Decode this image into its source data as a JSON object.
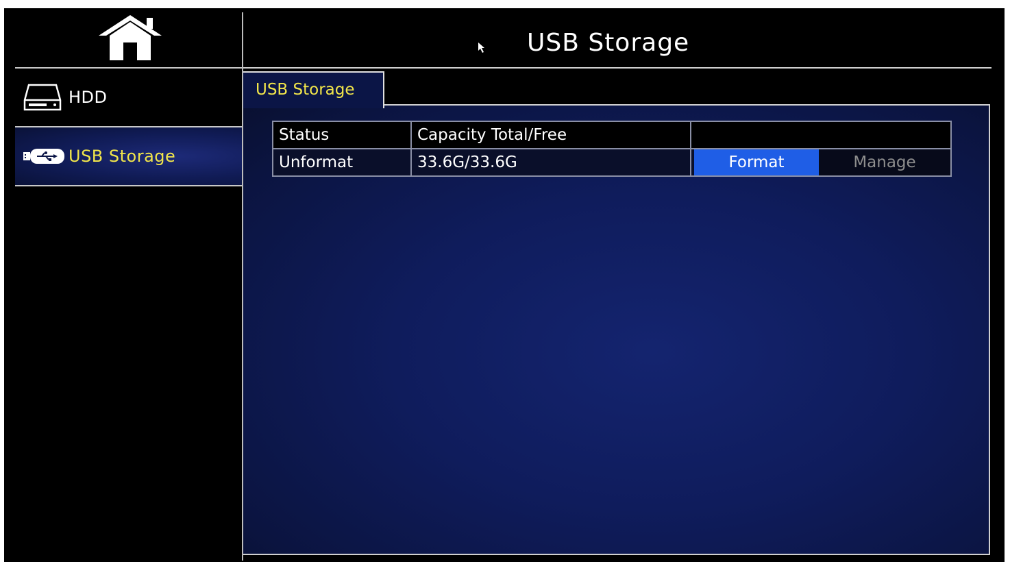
{
  "header": {
    "title": "USB Storage"
  },
  "sidebar": {
    "items": [
      {
        "label": "HDD",
        "icon": "hdd-icon"
      },
      {
        "label": "USB Storage",
        "icon": "usb-drive-icon",
        "selected": true
      }
    ]
  },
  "tabs": [
    {
      "label": "USB Storage"
    }
  ],
  "table": {
    "headers": [
      "Status",
      "Capacity Total/Free",
      ""
    ],
    "rows": [
      {
        "status": "Unformat",
        "capacity": "33.6G/33.6G"
      }
    ],
    "format_label": "Format",
    "manage_label": "Manage"
  },
  "colors": {
    "accent_yellow": "#f2e64a",
    "button_blue": "#1f5ee6",
    "panel_navy": "#0f1c5c"
  }
}
